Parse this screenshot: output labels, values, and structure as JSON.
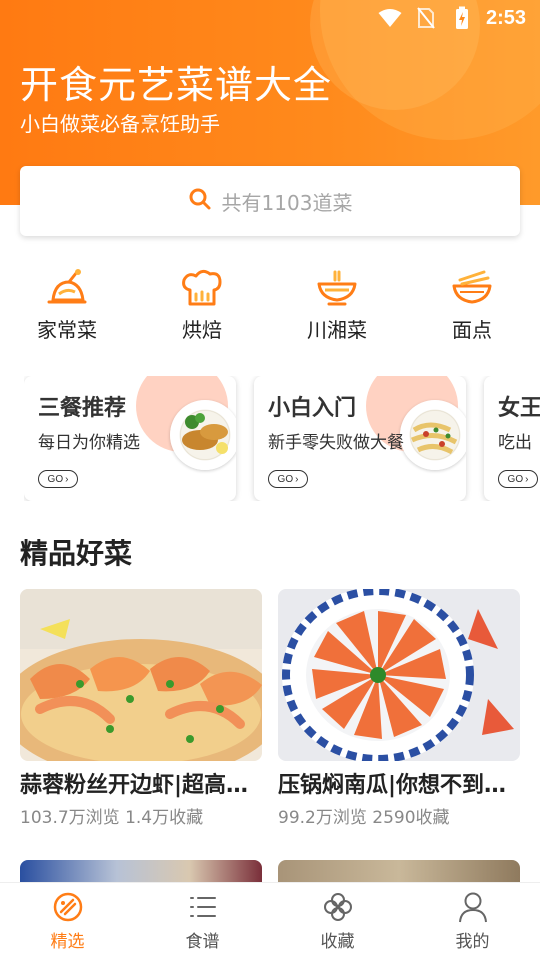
{
  "status": {
    "time": "2:53"
  },
  "header": {
    "title": "开食元艺菜谱大全",
    "subtitle": "小白做菜必备烹饪助手"
  },
  "search": {
    "placeholder": "共有1103道菜"
  },
  "categories": [
    {
      "label": "家常菜",
      "icon": "cooking-pot-icon"
    },
    {
      "label": "烘焙",
      "icon": "bread-icon"
    },
    {
      "label": "川湘菜",
      "icon": "hotpot-icon"
    },
    {
      "label": "面点",
      "icon": "noodle-bowl-icon"
    }
  ],
  "feature_cards": [
    {
      "title": "三餐推荐",
      "desc": "每日为你精选",
      "go": "GO"
    },
    {
      "title": "小白入门",
      "desc": "新手零失败做大餐",
      "go": "GO"
    },
    {
      "title": "女王",
      "desc": "吃出",
      "go": "GO"
    }
  ],
  "section": {
    "title": "精品好菜"
  },
  "recipes": [
    {
      "title": "蒜蓉粉丝开边虾|超高颜值",
      "stats": "103.7万浏览  1.4万收藏"
    },
    {
      "title": "压锅焖南瓜|你想不到的美味",
      "stats": "99.2万浏览  2590收藏"
    }
  ],
  "tabs": [
    {
      "label": "精选",
      "icon": "featured-icon",
      "active": true
    },
    {
      "label": "食谱",
      "icon": "list-icon",
      "active": false
    },
    {
      "label": "收藏",
      "icon": "clover-icon",
      "active": false
    },
    {
      "label": "我的",
      "icon": "user-icon",
      "active": false
    }
  ],
  "colors": {
    "accent": "#ff7d16",
    "header": "#ff8419",
    "card_blob": "#ffd2c2"
  }
}
